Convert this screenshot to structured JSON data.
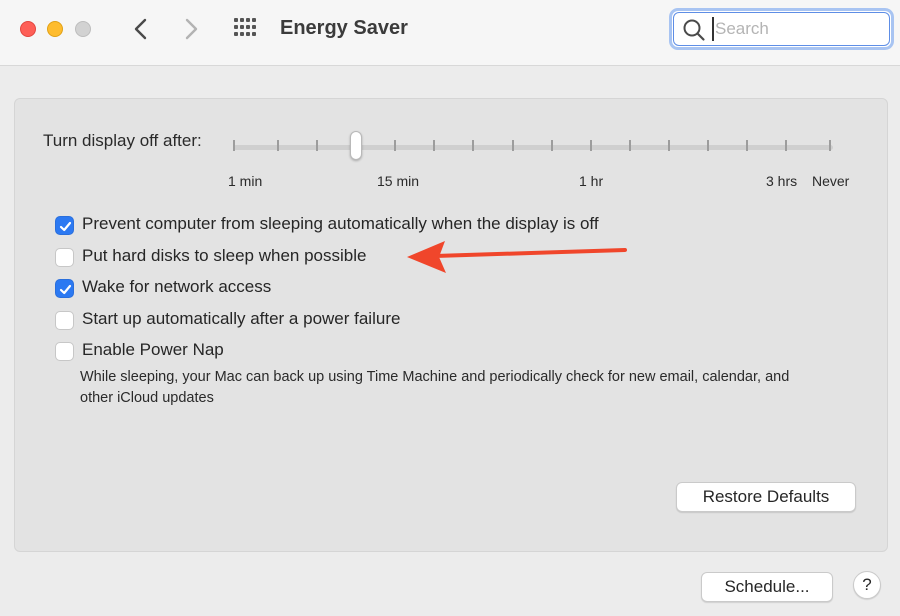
{
  "window": {
    "title": "Energy Saver",
    "search": {
      "placeholder": "Search",
      "value": ""
    }
  },
  "display_slider": {
    "label": "Turn display off after:",
    "tick_labels": [
      "1 min",
      "15 min",
      "1 hr",
      "3 hrs",
      "Never"
    ],
    "selected": "15 min"
  },
  "options": [
    {
      "label": "Prevent computer from sleeping automatically when the display is off",
      "checked": true
    },
    {
      "label": "Put hard disks to sleep when possible",
      "checked": false
    },
    {
      "label": "Wake for network access",
      "checked": true
    },
    {
      "label": "Start up automatically after a power failure",
      "checked": false
    },
    {
      "label": "Enable Power Nap",
      "checked": false
    }
  ],
  "power_nap_description": "While sleeping, your Mac can back up using Time Machine and periodically check for new email, calendar, and other iCloud updates",
  "buttons": {
    "restore_defaults": "Restore Defaults",
    "schedule": "Schedule...",
    "help": "?"
  },
  "colors": {
    "accent": "#2c79f2",
    "annotation_arrow": "#f0462b"
  }
}
